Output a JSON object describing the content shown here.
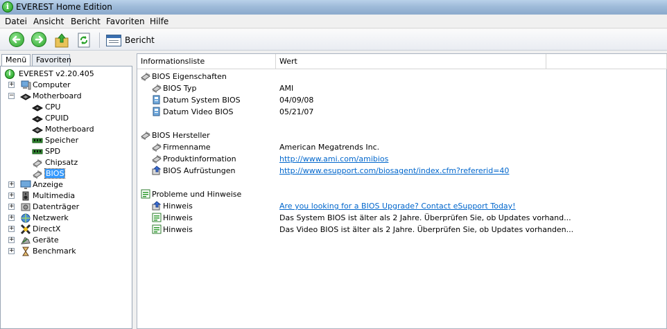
{
  "window": {
    "title": "EVEREST Home Edition"
  },
  "menu": [
    "Datei",
    "Ansicht",
    "Bericht",
    "Favoriten",
    "Hilfe"
  ],
  "toolbar": {
    "buttons": [
      {
        "name": "back-icon",
        "color": "#2aa22a"
      },
      {
        "name": "forward-icon",
        "color": "#2aa22a"
      },
      {
        "name": "up-icon",
        "color": "#e0b030"
      },
      {
        "name": "refresh-icon",
        "color": "#2aa22a"
      }
    ],
    "report_label": "Bericht"
  },
  "tabs": {
    "menu": "Menü",
    "favorites": "Favoriten"
  },
  "tree": {
    "root": "EVEREST v2.20.405",
    "items": [
      {
        "label": "Computer",
        "icon": "computer-icon",
        "expander": "+"
      },
      {
        "label": "Motherboard",
        "icon": "motherboard-icon",
        "expander": "−"
      },
      {
        "label": "CPU",
        "icon": "cpu-icon",
        "child": true
      },
      {
        "label": "CPUID",
        "icon": "cpu-icon",
        "child": true
      },
      {
        "label": "Motherboard",
        "icon": "motherboard-icon",
        "child": true
      },
      {
        "label": "Speicher",
        "icon": "memory-icon",
        "child": true
      },
      {
        "label": "SPD",
        "icon": "memory-icon",
        "child": true
      },
      {
        "label": "Chipsatz",
        "icon": "chip-icon",
        "child": true
      },
      {
        "label": "BIOS",
        "icon": "chip-icon",
        "child": true,
        "selected": true
      },
      {
        "label": "Anzeige",
        "icon": "monitor-icon",
        "expander": "+"
      },
      {
        "label": "Multimedia",
        "icon": "speaker-icon",
        "expander": "+"
      },
      {
        "label": "Datenträger",
        "icon": "disk-icon",
        "expander": "+"
      },
      {
        "label": "Netzwerk",
        "icon": "network-icon",
        "expander": "+"
      },
      {
        "label": "DirectX",
        "icon": "directx-icon",
        "expander": "+"
      },
      {
        "label": "Geräte",
        "icon": "devices-icon",
        "expander": "+"
      },
      {
        "label": "Benchmark",
        "icon": "hourglass-icon",
        "expander": "+"
      }
    ]
  },
  "list": {
    "columns": {
      "name": "Informationsliste",
      "value": "Wert"
    },
    "sections": [
      {
        "title": "BIOS Eigenschaften",
        "icon": "chip-icon",
        "rows": [
          {
            "name": "BIOS Typ",
            "value": "AMI",
            "icon": "chip-icon",
            "link": false
          },
          {
            "name": "Datum System BIOS",
            "value": "04/09/08",
            "icon": "calendar-icon",
            "link": false
          },
          {
            "name": "Datum Video BIOS",
            "value": "05/21/07",
            "icon": "calendar-icon",
            "link": false
          }
        ]
      },
      {
        "title": "BIOS Hersteller",
        "icon": "chip-icon",
        "rows": [
          {
            "name": "Firmenname",
            "value": "American Megatrends Inc.",
            "icon": "chip-icon",
            "link": false
          },
          {
            "name": "Produktinformation",
            "value": "http://www.ami.com/amibios",
            "icon": "chip-icon",
            "link": true
          },
          {
            "name": "BIOS Aufrüstungen",
            "value": "http://www.esupport.com/biosagent/index.cfm?refererid=40",
            "icon": "upgrade-icon",
            "link": true
          }
        ]
      },
      {
        "title": "Probleme und Hinweise",
        "icon": "notice-icon",
        "rows": [
          {
            "name": "Hinweis",
            "value": "Are you looking for a BIOS Upgrade?  Contact eSupport Today!",
            "icon": "upgrade-icon",
            "link": true
          },
          {
            "name": "Hinweis",
            "value": "Das System BIOS ist älter als 2 Jahre. Überprüfen Sie, ob Updates vorhand...",
            "icon": "notice-icon",
            "link": false
          },
          {
            "name": "Hinweis",
            "value": "Das Video BIOS ist älter als 2 Jahre. Überprüfen Sie, ob Updates vorhanden...",
            "icon": "notice-icon",
            "link": false
          }
        ]
      }
    ]
  }
}
